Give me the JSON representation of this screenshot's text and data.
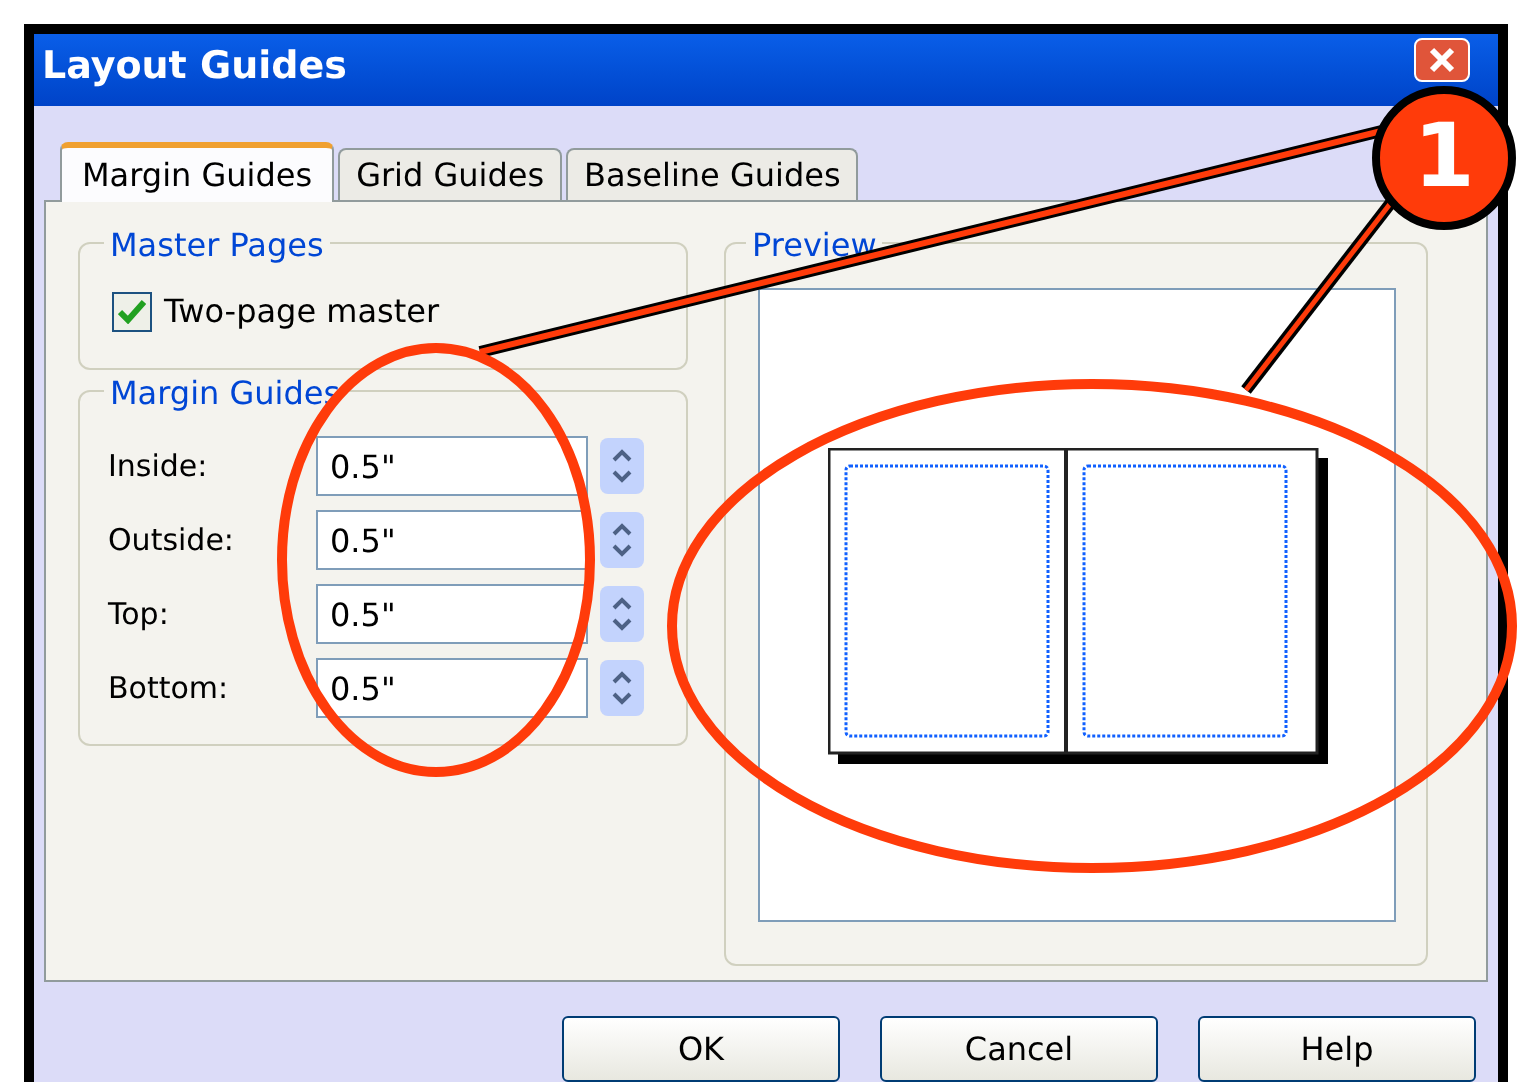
{
  "window": {
    "title": "Layout Guides"
  },
  "tabs": [
    {
      "label": "Margin Guides",
      "selected": true
    },
    {
      "label": "Grid Guides",
      "selected": false
    },
    {
      "label": "Baseline Guides",
      "selected": false
    }
  ],
  "master_pages": {
    "title": "Master Pages",
    "checkbox": {
      "label": "Two-page master",
      "checked": true
    }
  },
  "margin_guides": {
    "title": "Margin Guides",
    "fields": [
      {
        "label": "Inside:",
        "value": "0.5\""
      },
      {
        "label": "Outside:",
        "value": "0.5\""
      },
      {
        "label": "Top:",
        "value": "0.5\""
      },
      {
        "label": "Bottom:",
        "value": "0.5\""
      }
    ]
  },
  "preview": {
    "title": "Preview"
  },
  "buttons": [
    "OK",
    "Cancel",
    "Help"
  ],
  "callout": {
    "number": "1"
  }
}
